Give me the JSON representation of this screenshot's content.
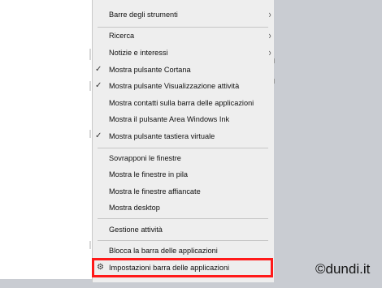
{
  "menu": {
    "items": [
      {
        "label": "Barre degli strumenti",
        "checked": false,
        "submenu": true
      },
      {
        "label": "Ricerca",
        "checked": false,
        "submenu": true
      },
      {
        "label": "Notizie e interessi",
        "checked": false,
        "submenu": true
      },
      {
        "label": "Mostra pulsante Cortana",
        "checked": true,
        "submenu": false
      },
      {
        "label": "Mostra pulsante Visualizzazione attività",
        "checked": true,
        "submenu": false
      },
      {
        "label": "Mostra contatti sulla barra delle applicazioni",
        "checked": false,
        "submenu": false
      },
      {
        "label": "Mostra il pulsante Area Windows Ink",
        "checked": false,
        "submenu": false
      },
      {
        "label": "Mostra pulsante tastiera virtuale",
        "checked": true,
        "submenu": false
      },
      {
        "label": "Sovrapponi le finestre",
        "checked": false,
        "submenu": false
      },
      {
        "label": "Mostra le finestre in pila",
        "checked": false,
        "submenu": false
      },
      {
        "label": "Mostra le finestre affiancate",
        "checked": false,
        "submenu": false
      },
      {
        "label": "Mostra desktop",
        "checked": false,
        "submenu": false
      },
      {
        "label": "Gestione attività",
        "checked": false,
        "submenu": false
      },
      {
        "label": "Blocca la barra delle applicazioni",
        "checked": false,
        "submenu": false
      },
      {
        "label": "Impostazioni barra delle applicazioni",
        "checked": false,
        "submenu": false,
        "icon": "gear-icon",
        "highlighted": true
      }
    ],
    "check_glyph": "✓",
    "chevron_glyph": "›",
    "gear_glyph": "⚙"
  },
  "watermark": "©dundi.it",
  "colors": {
    "menu_background": "#eeeeee",
    "highlight_border": "#ff1a1a",
    "desktop_background": "#c9ccd2"
  }
}
